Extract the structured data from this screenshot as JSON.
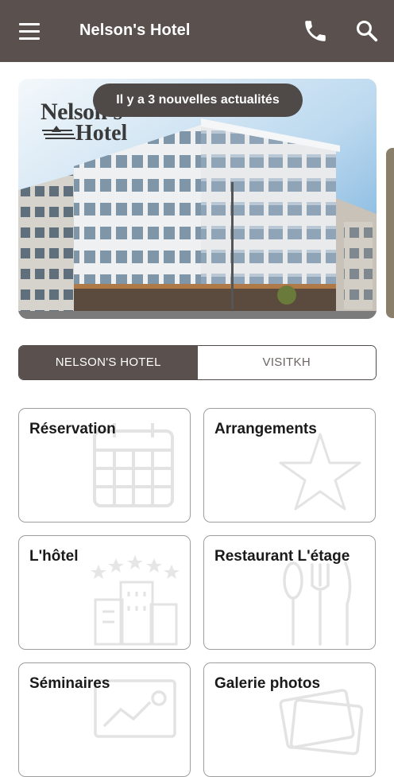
{
  "app": {
    "title": "Nelson's Hotel",
    "icons": {
      "menu": "menu-icon",
      "phone": "phone-icon",
      "search": "search-icon"
    }
  },
  "banner": {
    "news_pill": "Il y a 3 nouvelles actualités",
    "logo_line1": "Nelson's",
    "logo_line2": "Hotel"
  },
  "tabs": [
    {
      "label": "NELSON'S HOTEL",
      "active": true
    },
    {
      "label": "VISITKH",
      "active": false
    }
  ],
  "tiles": [
    {
      "label": "Réservation",
      "icon": "calendar-icon"
    },
    {
      "label": "Arrangements",
      "icon": "star-icon"
    },
    {
      "label": "L'hôtel",
      "icon": "hotel-building-icon"
    },
    {
      "label": "Restaurant L'étage",
      "icon": "cutlery-icon"
    },
    {
      "label": "Séminaires",
      "icon": "presentation-icon"
    },
    {
      "label": "Galerie photos",
      "icon": "photo-gallery-icon"
    }
  ],
  "colors": {
    "appbar": "#5a514e",
    "accent": "#4f4947",
    "tile_border": "#9e9e9e",
    "icon_watermark": "#e3e3e3"
  }
}
